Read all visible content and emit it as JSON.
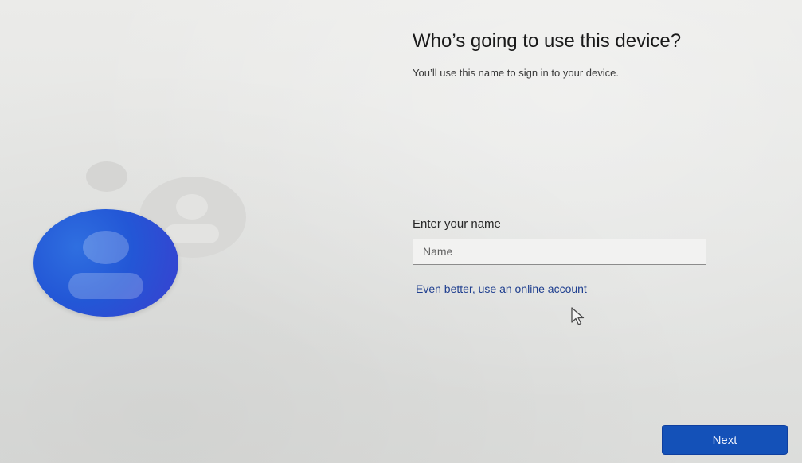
{
  "oobe": {
    "title": "Who’s going to use this device?",
    "subtitle": "You’ll use this name to sign in to your device.",
    "name_label": "Enter your name",
    "name_input": {
      "value": "",
      "placeholder": "Name"
    },
    "online_account_link": "Even better, use an online account",
    "next_label": "Next"
  },
  "illustration": {
    "icons": [
      "user-avatar-icon",
      "secondary-user-avatar-icon",
      "small-avatar-dot-icon"
    ]
  },
  "colors": {
    "accent_blue": "#1451b8",
    "avatar_blue": "#2357d6",
    "link_blue": "#1f3f8f",
    "background": "#e3e4e2"
  }
}
